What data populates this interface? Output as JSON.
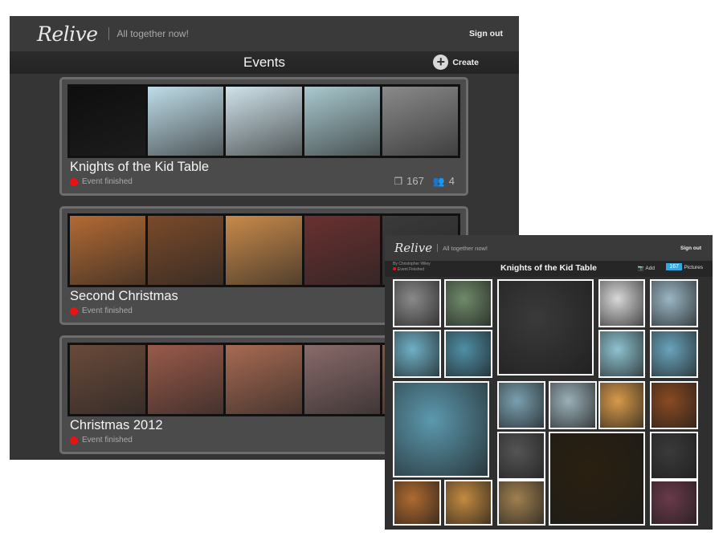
{
  "main": {
    "logo": "Relive",
    "tagline": "All together now!",
    "signout": "Sign out",
    "title": "Events",
    "create": "Create",
    "events": [
      {
        "name": "Knights of the Kid Table",
        "status": "Event finished",
        "photos": "167",
        "people": "4",
        "strip": [
          "#0e0e0e",
          "#bfdde8",
          "#cfe3ea",
          "#a9c9cf",
          "#8a8a8a"
        ]
      },
      {
        "name": "Second Christmas",
        "status": "Event finished",
        "strip": [
          "#b36a33",
          "#7a4a2a",
          "#c98a4a",
          "#6a3030",
          "#3a3a3a"
        ]
      },
      {
        "name": "Christmas 2012",
        "status": "Event finished",
        "strip": [
          "#6a4a3a",
          "#9a5a4a",
          "#a86a52",
          "#8a6a6a",
          "#7a5a4a"
        ]
      }
    ]
  },
  "side": {
    "logo": "Relive",
    "tagline": "All together now!",
    "signout": "Sign out",
    "by": "By Christopher Wiley",
    "status": "Event Finished",
    "event_title": "Knights of the Kid Table",
    "add": "Add",
    "count": "167",
    "pictures": "Pictures"
  }
}
